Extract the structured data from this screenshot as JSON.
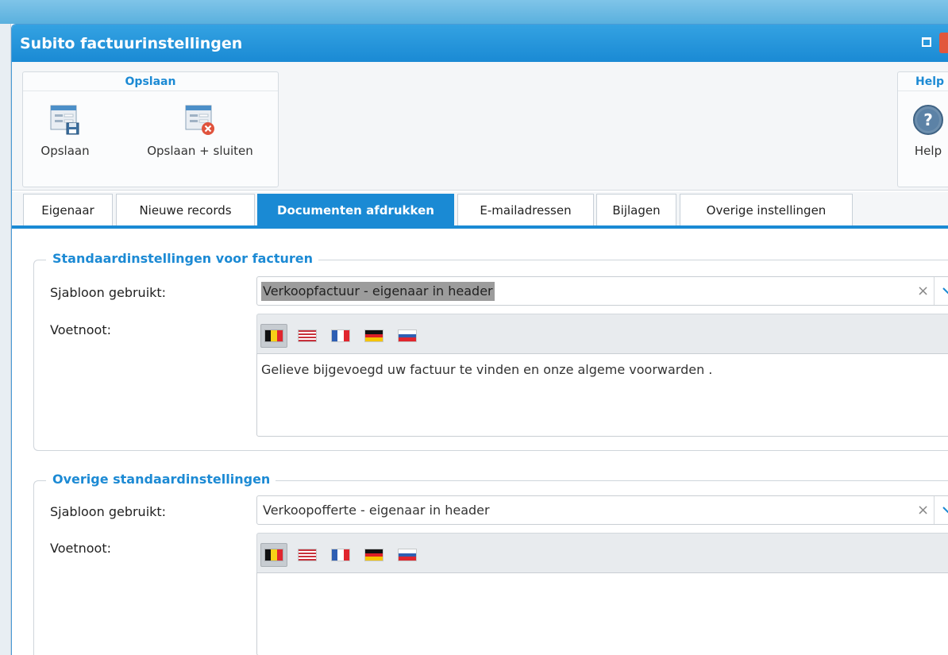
{
  "window": {
    "title": "Subito factuurinstellingen"
  },
  "ribbon": {
    "save_group": {
      "title": "Opslaan",
      "save_label": "Opslaan",
      "save_close_label": "Opslaan + sluiten"
    },
    "help_group": {
      "title": "Help",
      "help_label": "Help"
    }
  },
  "tabs": [
    {
      "label": "Eigenaar",
      "active": false
    },
    {
      "label": "Nieuwe records",
      "active": false
    },
    {
      "label": "Documenten afdrukken",
      "active": true
    },
    {
      "label": "E-mailadressen",
      "active": false
    },
    {
      "label": "Bijlagen",
      "active": false
    },
    {
      "label": "Overige instellingen",
      "active": false
    }
  ],
  "invoices": {
    "legend": "Standaardinstellingen voor facturen",
    "template_label": "Sjabloon gebruikt:",
    "template_value": "Verkoopfactuur - eigenaar in header",
    "footnote_label": "Voetnoot:",
    "footnote_text": "Gelieve bijgevoegd uw factuur te vinden en onze algeme voorwarden ."
  },
  "other": {
    "legend": "Overige standaardinstellingen",
    "template_label": "Sjabloon gebruikt:",
    "template_value": "Verkoopofferte - eigenaar in header",
    "footnote_label": "Voetnoot:",
    "footnote_text": ""
  },
  "languages": [
    "Nederlands (BE)",
    "English (US)",
    "Français",
    "Deutsch",
    "Slovenčina"
  ],
  "colors": {
    "accent": "#1a8ad4",
    "titlebar": "#1a8ad4",
    "close": "#e2573c"
  }
}
